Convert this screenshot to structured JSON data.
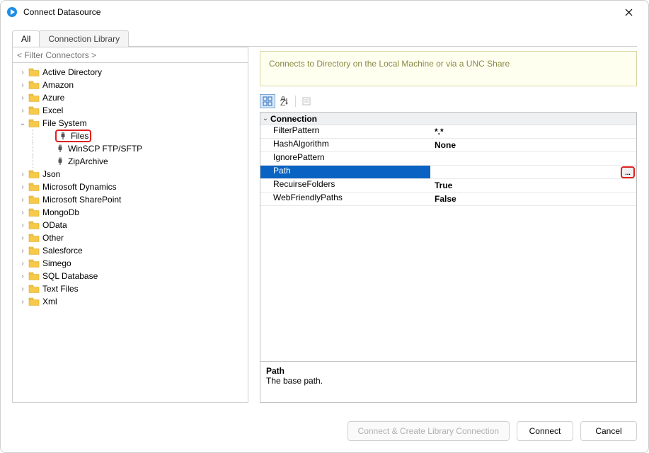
{
  "titlebar": {
    "title": "Connect Datasource"
  },
  "tabs": {
    "all": "All",
    "library": "Connection Library"
  },
  "filter": {
    "placeholder": "< Filter Connectors >"
  },
  "tree": [
    {
      "label": "Active Directory",
      "type": "folder",
      "level": 0,
      "expander": "›"
    },
    {
      "label": "Amazon",
      "type": "folder",
      "level": 0,
      "expander": "›"
    },
    {
      "label": "Azure",
      "type": "folder",
      "level": 0,
      "expander": "›"
    },
    {
      "label": "Excel",
      "type": "folder",
      "level": 0,
      "expander": "›"
    },
    {
      "label": "File System",
      "type": "folder",
      "level": 0,
      "expander": "⌄",
      "expanded": true
    },
    {
      "label": "Files",
      "type": "leaf",
      "level": 1,
      "expander": "",
      "selected": true
    },
    {
      "label": "WinSCP FTP/SFTP",
      "type": "leaf",
      "level": 1,
      "expander": ""
    },
    {
      "label": "ZipArchive",
      "type": "leaf",
      "level": 1,
      "expander": ""
    },
    {
      "label": "Json",
      "type": "folder",
      "level": 0,
      "expander": "›"
    },
    {
      "label": "Microsoft Dynamics",
      "type": "folder",
      "level": 0,
      "expander": "›"
    },
    {
      "label": "Microsoft SharePoint",
      "type": "folder",
      "level": 0,
      "expander": "›"
    },
    {
      "label": "MongoDb",
      "type": "folder",
      "level": 0,
      "expander": "›"
    },
    {
      "label": "OData",
      "type": "folder",
      "level": 0,
      "expander": "›"
    },
    {
      "label": "Other",
      "type": "folder",
      "level": 0,
      "expander": "›"
    },
    {
      "label": "Salesforce",
      "type": "folder",
      "level": 0,
      "expander": "›"
    },
    {
      "label": "Simego",
      "type": "folder",
      "level": 0,
      "expander": "›"
    },
    {
      "label": "SQL Database",
      "type": "folder",
      "level": 0,
      "expander": "›"
    },
    {
      "label": "Text Files",
      "type": "folder",
      "level": 0,
      "expander": "›"
    },
    {
      "label": "Xml",
      "type": "folder",
      "level": 0,
      "expander": "›"
    }
  ],
  "info": "Connects to Directory on the Local Machine or via a UNC Share",
  "category": {
    "label": "Connection",
    "expander": "⌄"
  },
  "props": [
    {
      "name": "FilterPattern",
      "value": "*.*"
    },
    {
      "name": "HashAlgorithm",
      "value": "None"
    },
    {
      "name": "IgnorePattern",
      "value": ""
    },
    {
      "name": "Path",
      "value": "",
      "selected": true,
      "ellipsis": "..."
    },
    {
      "name": "RecuirseFolders",
      "value": "True"
    },
    {
      "name": "WebFriendlyPaths",
      "value": "False"
    }
  ],
  "desc": {
    "title": "Path",
    "body": "The base path."
  },
  "buttons": {
    "createLib": "Connect & Create Library Connection",
    "connect": "Connect",
    "cancel": "Cancel"
  }
}
